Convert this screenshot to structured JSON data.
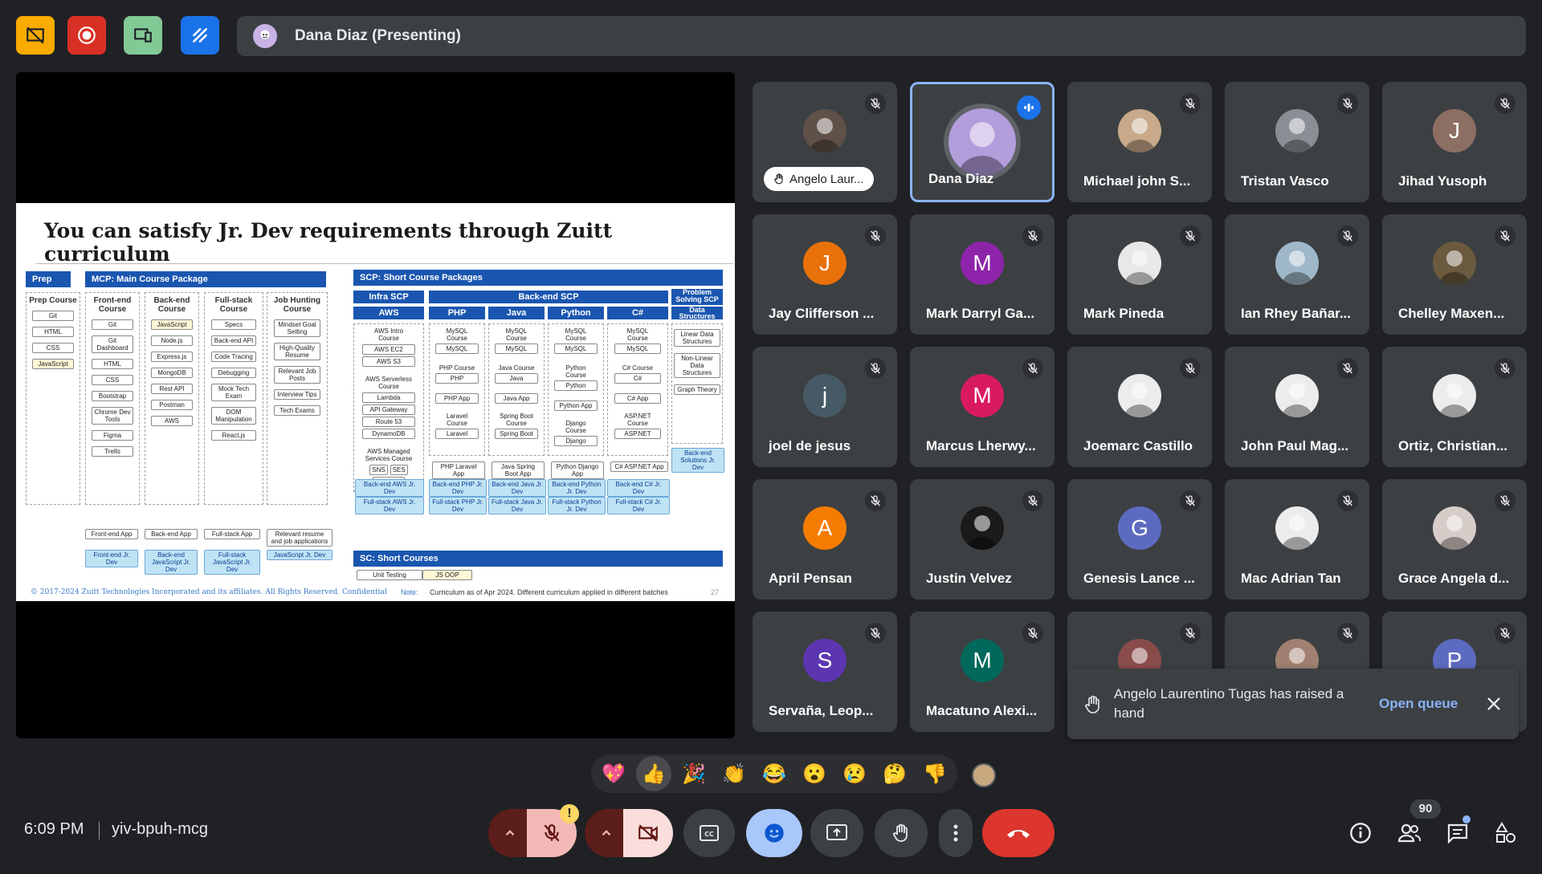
{
  "top_bar": {
    "buttons": [
      {
        "icon": "no-camera-presentation-icon",
        "color": "#f9ab00"
      },
      {
        "icon": "record-icon",
        "color": "#d93025"
      },
      {
        "icon": "companion-mode-icon",
        "color": "#81c995"
      },
      {
        "icon": "whiteboard-icon",
        "color": "#1a73e8"
      }
    ],
    "presenting_label": "Dana Diaz (Presenting)"
  },
  "slide": {
    "title": "You can satisfy Jr. Dev requirements through Zuitt curriculum",
    "sections": {
      "prep": "Prep",
      "mcp": "MCP: Main Course Package",
      "scp": "SCP: Short Course Packages",
      "sc": "SC: Short Courses"
    },
    "mcp_columns": [
      {
        "title": "Prep Course",
        "items": [
          "Git",
          "HTML",
          "CSS",
          "JavaScript"
        ],
        "result": ""
      },
      {
        "title": "Front-end Course",
        "items": [
          "Git",
          "Git Dashboard",
          "HTML",
          "CSS",
          "Bootstrap",
          "Chrome Dev Tools",
          "Figma",
          "Trello"
        ],
        "result": "Front-end App",
        "badge": "Front-end Jr. Dev"
      },
      {
        "title": "Back-end Course",
        "items": [
          "JavaScript",
          "Node.js",
          "Express.js",
          "MongoDB",
          "Rest API",
          "Postman",
          "AWS"
        ],
        "result": "Back-end App",
        "badge": "Back-end JavaScript Jr. Dev"
      },
      {
        "title": "Full-stack Course",
        "items": [
          "Specs",
          "Back-end API",
          "Code Tracing",
          "Debugging",
          "Mock Tech Exam",
          "DOM Manipulation",
          "React.js"
        ],
        "result": "Full-stack App",
        "badge": "Full-stack JavaScript Jr. Dev"
      },
      {
        "title": "Job Hunting Course",
        "items": [
          "Mindset Goal Setting",
          "High-Quality Resume",
          "Relevant Job Posts",
          "Interview Tips",
          "Tech Exams"
        ],
        "result": "Relevant resume and job applications",
        "badge": "JavaScript Jr. Dev"
      }
    ],
    "scp_headers": {
      "infra": "Infra SCP",
      "backend": "Back-end SCP",
      "problem": "Problem Solving SCP",
      "aws": "AWS",
      "php": "PHP",
      "java": "Java",
      "python": "Python",
      "csharp": "C#",
      "ds": "Data Structures"
    },
    "aws_items": [
      "AWS Intro Course",
      "AWS EC2",
      "AWS S3",
      "AWS Serverless Course",
      "Lambda",
      "API Gateway",
      "Route 53",
      "DynamoDB",
      "AWS Managed Services Course",
      "SNS",
      "SES",
      "SQS"
    ],
    "aws_badges": [
      "Back-end AWS Jr. Dev",
      "Full-stack AWS Jr. Dev"
    ],
    "lang_columns": [
      {
        "items": [
          "MySQL Course",
          "MySQL",
          "PHP Course",
          "PHP",
          "PHP App",
          "Laravel Course",
          "Laravel",
          "PHP Laravel App"
        ],
        "badges": [
          "Back-end PHP Jr. Dev",
          "Full-stack PHP Jr. Dev"
        ]
      },
      {
        "items": [
          "MySQL Course",
          "MySQL",
          "Java Course",
          "Java",
          "Java App",
          "Spring Boot Course",
          "Spring Boot",
          "Java Spring Boot App"
        ],
        "badges": [
          "Back-end Java Jr. Dev",
          "Full-stack Java Jr. Dev"
        ]
      },
      {
        "items": [
          "MySQL Course",
          "MySQL",
          "Python Course",
          "Python",
          "Python App",
          "Django Course",
          "Django",
          "Python Django App"
        ],
        "badges": [
          "Back-end Python Jr. Dev",
          "Full-stack Python Jr. Dev"
        ]
      },
      {
        "items": [
          "MySQL Course",
          "MySQL",
          "C# Course",
          "C#",
          "C# App",
          "ASP.NET Course",
          "ASP.NET",
          "C# ASP.NET App"
        ],
        "badges": [
          "Back-end C# Jr. Dev",
          "Full-stack C# Jr. Dev"
        ]
      }
    ],
    "ds_items": [
      "Linear Data Structures",
      "Non-Linear Data Structures",
      "Graph Theory"
    ],
    "ds_badge": "Back-end Solutions Jr. Dev",
    "short_courses": [
      "Unit Testing",
      "JS OOP"
    ],
    "copyright": "© 2017-2024 Zuitt Technologies Incorporated and its affiliates. All Rights Reserved. Confidential",
    "note_label": "Note:",
    "note": "Curriculum as of Apr 2024. Different curriculum applied in different batches",
    "page": "27"
  },
  "participants": [
    {
      "name": "Angelo Laur...",
      "avatar": "photo",
      "color": "#5f5048",
      "muted": true,
      "hand": true
    },
    {
      "name": "Dana Diaz",
      "avatar": "photo",
      "color": "#b39ddb",
      "muted": false,
      "speaking": true
    },
    {
      "name": "Michael john S...",
      "avatar": "photo",
      "color": "#c8a98a",
      "muted": true
    },
    {
      "name": "Tristan Vasco",
      "avatar": "photo",
      "color": "#8a8f96",
      "muted": true
    },
    {
      "name": "Jihad Yusoph",
      "avatar": "J",
      "color": "#8d6e63",
      "muted": true
    },
    {
      "name": "Jay Clifferson ...",
      "avatar": "J",
      "color": "#e8710a",
      "muted": true
    },
    {
      "name": "Mark Darryl Ga...",
      "avatar": "M",
      "color": "#8e24aa",
      "muted": true
    },
    {
      "name": "Mark Pineda",
      "avatar": "photo",
      "color": "#e8e8e8",
      "muted": true
    },
    {
      "name": "Ian Rhey Bañar...",
      "avatar": "photo",
      "color": "#9fb8c9",
      "muted": true
    },
    {
      "name": "Chelley Maxen...",
      "avatar": "photo",
      "color": "#6b5a3e",
      "muted": true
    },
    {
      "name": "joel de jesus",
      "avatar": "j",
      "color": "#455a64",
      "muted": true
    },
    {
      "name": "Marcus Lherwy...",
      "avatar": "M",
      "color": "#d81b60",
      "muted": true
    },
    {
      "name": "Joemarc Castillo",
      "avatar": "photo",
      "color": "#ececec",
      "muted": true
    },
    {
      "name": "John Paul Mag...",
      "avatar": "photo",
      "color": "#ececec",
      "muted": true
    },
    {
      "name": "Ortiz, Christian...",
      "avatar": "photo",
      "color": "#ececec",
      "muted": true
    },
    {
      "name": "April Pensan",
      "avatar": "A",
      "color": "#f57c00",
      "muted": true
    },
    {
      "name": "Justin Velvez",
      "avatar": "photo",
      "color": "#1a1a1a",
      "muted": true
    },
    {
      "name": "Genesis Lance ...",
      "avatar": "G",
      "color": "#5c6bc0",
      "muted": true
    },
    {
      "name": "Mac Adrian Tan",
      "avatar": "photo",
      "color": "#ececec",
      "muted": true
    },
    {
      "name": "Grace Angela d...",
      "avatar": "photo",
      "color": "#d7ccc8",
      "muted": true
    },
    {
      "name": "Servaña, Leop...",
      "avatar": "S",
      "color": "#5e35b1",
      "muted": true
    },
    {
      "name": "Macatuno Alexi...",
      "avatar": "M",
      "color": "#00695c",
      "muted": true
    },
    {
      "name": "",
      "avatar": "photo",
      "color": "#8a4b4b",
      "muted": true
    },
    {
      "name": "",
      "avatar": "photo",
      "color": "#a08070",
      "muted": true
    },
    {
      "name": "",
      "avatar": "P",
      "color": "#5c6bc0",
      "muted": true
    }
  ],
  "toast": {
    "message": "Angelo Laurentino Tugas has raised a hand",
    "action": "Open queue"
  },
  "reactions": [
    "💖",
    "👍",
    "🎉",
    "👏",
    "😂",
    "😮",
    "😢",
    "🤔",
    "👎"
  ],
  "bottom": {
    "time": "6:09 PM",
    "meeting_code": "yiv-bpuh-mcg",
    "people_count": "90",
    "mic_warning": "!"
  }
}
